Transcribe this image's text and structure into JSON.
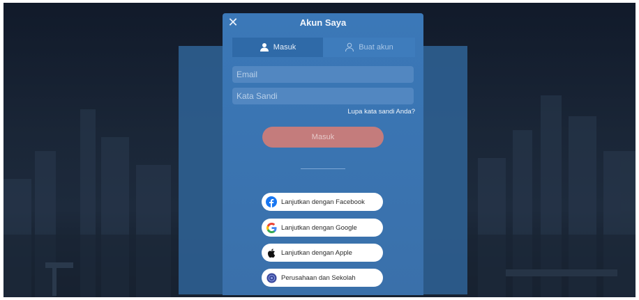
{
  "modal": {
    "title": "Akun Saya",
    "close_icon": "close-icon",
    "tabs": [
      {
        "label": "Masuk",
        "icon": "user-filled-icon",
        "active": true
      },
      {
        "label": "Buat akun",
        "icon": "user-outline-icon",
        "active": false
      }
    ],
    "email_placeholder": "Email",
    "password_placeholder": "Kata Sandi",
    "forgot_label": "Lupa kata sandi Anda?",
    "submit_label": "Masuk",
    "social": [
      {
        "label": "Lanjutkan dengan Facebook",
        "icon": "facebook-icon"
      },
      {
        "label": "Lanjutkan dengan Google",
        "icon": "google-icon"
      },
      {
        "label": "Lanjutkan dengan Apple",
        "icon": "apple-icon"
      },
      {
        "label": "Perusahaan dan Sekolah",
        "icon": "institution-icon"
      }
    ]
  },
  "colors": {
    "modal_bg": "#3b78b8",
    "submit_bg": "#c47c7c",
    "facebook": "#1877f2"
  }
}
